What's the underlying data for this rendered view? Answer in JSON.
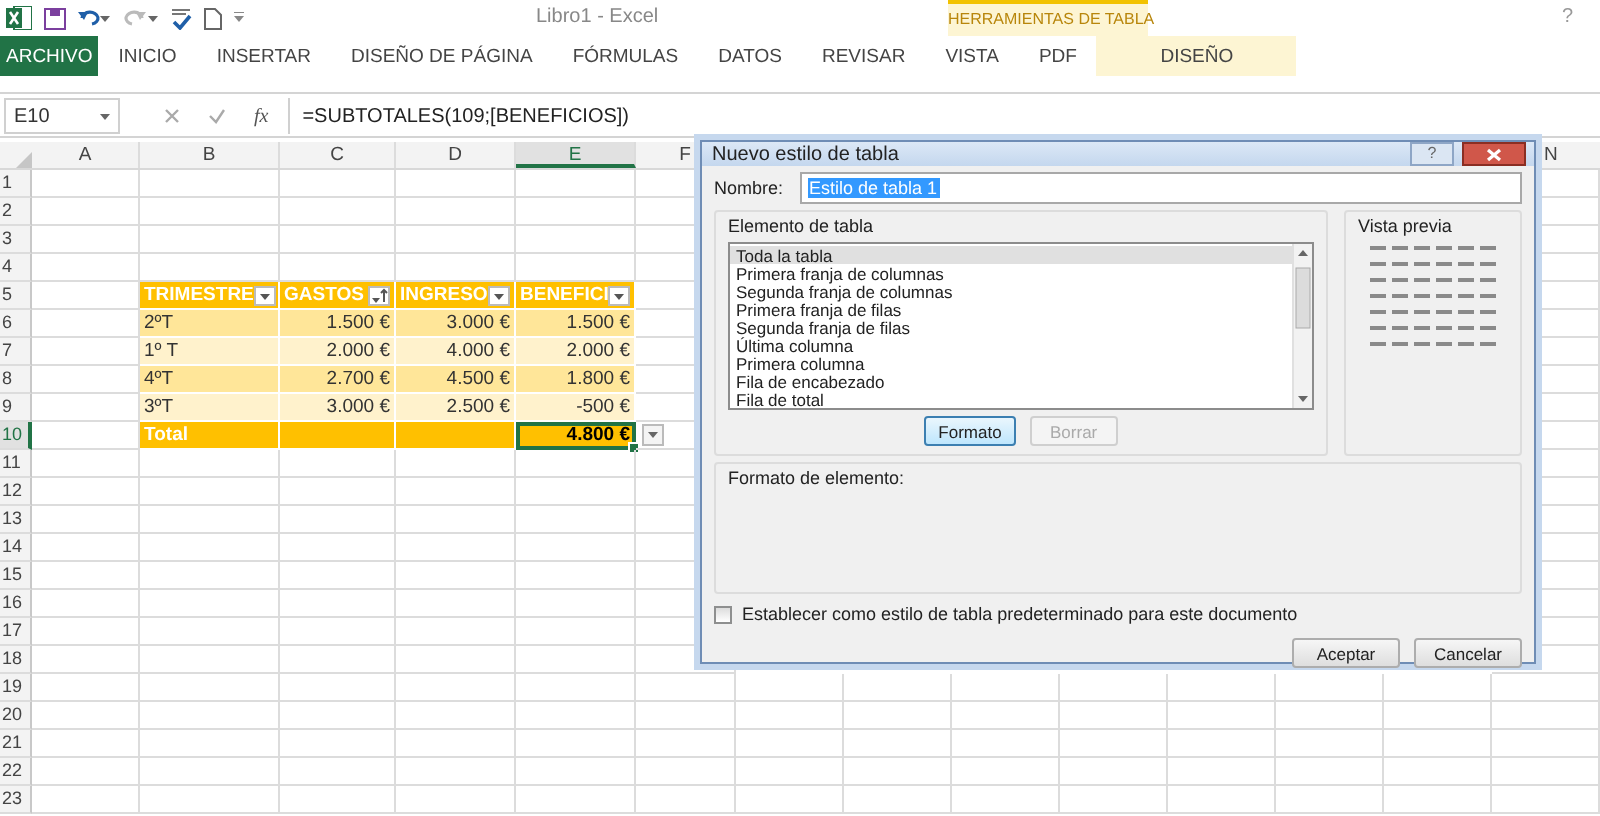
{
  "window": {
    "title": "Libro1 - Excel",
    "help": "?"
  },
  "ribbon": {
    "tabs": [
      {
        "label": "ARCHIVO",
        "kind": "file",
        "selected": false
      },
      {
        "label": "INICIO",
        "kind": "tab",
        "selected": false
      },
      {
        "label": "INSERTAR",
        "kind": "tab",
        "selected": false
      },
      {
        "label": "DISEÑO DE PÁGINA",
        "kind": "tab",
        "selected": false
      },
      {
        "label": "FÓRMULAS",
        "kind": "tab",
        "selected": false
      },
      {
        "label": "DATOS",
        "kind": "tab",
        "selected": false
      },
      {
        "label": "REVISAR",
        "kind": "tab",
        "selected": false
      },
      {
        "label": "VISTA",
        "kind": "tab",
        "selected": false
      },
      {
        "label": "PDF",
        "kind": "tab",
        "selected": false
      }
    ],
    "contextual": {
      "group": "HERRAMIENTAS DE TABLA",
      "tabs": [
        {
          "label": "DISEÑO",
          "selected": false
        }
      ]
    }
  },
  "formula_bar": {
    "name_box": "E10",
    "function_label": "fx",
    "formula": "=SUBTOTALES(109;[BENEFICIOS])"
  },
  "sheet": {
    "columns": [
      {
        "label": "A",
        "selected": false
      },
      {
        "label": "B",
        "selected": false
      },
      {
        "label": "C",
        "selected": false
      },
      {
        "label": "D",
        "selected": false
      },
      {
        "label": "E",
        "selected": true
      },
      {
        "label": "F",
        "selected": false
      },
      {
        "label": "N",
        "selected": false
      }
    ],
    "rows": [
      {
        "number": "1",
        "selected": false,
        "kind": "blank"
      },
      {
        "number": "2",
        "selected": false,
        "kind": "blank"
      },
      {
        "number": "3",
        "selected": false,
        "kind": "blank"
      },
      {
        "number": "4",
        "selected": false,
        "kind": "blank"
      },
      {
        "number": "5",
        "selected": false,
        "kind": "header",
        "cells": [
          {
            "text": "TRIMESTRE",
            "sorted": false,
            "selected": false
          },
          {
            "text": "GASTOS",
            "sorted": true,
            "selected": false
          },
          {
            "text": "INGRESO",
            "sorted": false,
            "selected": false
          },
          {
            "text": "BENEFICI",
            "sorted": false,
            "selected": false
          }
        ]
      },
      {
        "number": "6",
        "selected": false,
        "kind": "band1",
        "cells": [
          {
            "text": "2ºT",
            "selected": false
          },
          {
            "text": "1.500 €",
            "selected": false
          },
          {
            "text": "3.000 €",
            "selected": false
          },
          {
            "text": "1.500 €",
            "selected": false
          }
        ]
      },
      {
        "number": "7",
        "selected": false,
        "kind": "band2",
        "cells": [
          {
            "text": "1º T",
            "selected": false
          },
          {
            "text": "2.000 €",
            "selected": false
          },
          {
            "text": "4.000 €",
            "selected": false
          },
          {
            "text": "2.000 €",
            "selected": false
          }
        ]
      },
      {
        "number": "8",
        "selected": false,
        "kind": "band1",
        "cells": [
          {
            "text": "4ºT",
            "selected": false
          },
          {
            "text": "2.700 €",
            "selected": false
          },
          {
            "text": "4.500 €",
            "selected": false
          },
          {
            "text": "1.800 €",
            "selected": false
          }
        ]
      },
      {
        "number": "9",
        "selected": false,
        "kind": "band2",
        "cells": [
          {
            "text": "3ºT",
            "selected": false
          },
          {
            "text": "3.000 €",
            "selected": false
          },
          {
            "text": "2.500 €",
            "selected": false
          },
          {
            "text": "-500 €",
            "selected": false
          }
        ]
      },
      {
        "number": "10",
        "selected": true,
        "kind": "total",
        "total_dropdown": true,
        "cells": [
          {
            "text": "Total",
            "selected": false
          },
          {
            "selected": false
          },
          {
            "selected": false
          },
          {
            "text": "4.800 €",
            "selected": true
          }
        ]
      },
      {
        "number": "11",
        "selected": false,
        "kind": "blank"
      },
      {
        "number": "12",
        "selected": false,
        "kind": "blank"
      },
      {
        "number": "13",
        "selected": false,
        "kind": "blank"
      },
      {
        "number": "14",
        "selected": false,
        "kind": "blank"
      },
      {
        "number": "15",
        "selected": false,
        "kind": "blank"
      },
      {
        "number": "16",
        "selected": false,
        "kind": "blank"
      },
      {
        "number": "17",
        "selected": false,
        "kind": "blank"
      },
      {
        "number": "18",
        "selected": false,
        "kind": "blank"
      },
      {
        "number": "19",
        "selected": false,
        "kind": "blank"
      },
      {
        "number": "20",
        "selected": false,
        "kind": "blank"
      },
      {
        "number": "21",
        "selected": false,
        "kind": "blank"
      },
      {
        "number": "22",
        "selected": false,
        "kind": "blank"
      },
      {
        "number": "23",
        "selected": false,
        "kind": "blank"
      }
    ]
  },
  "dialog": {
    "title": "Nuevo estilo de tabla",
    "help": "?",
    "name_label": "Nombre:",
    "name_value": "Estilo de tabla 1",
    "elements_label": "Elemento de tabla",
    "elements": [
      {
        "label": "Toda la tabla",
        "selected": true
      },
      {
        "label": "Primera franja de columnas",
        "selected": false
      },
      {
        "label": "Segunda franja de columnas",
        "selected": false
      },
      {
        "label": "Primera franja de filas",
        "selected": false
      },
      {
        "label": "Segunda franja de filas",
        "selected": false
      },
      {
        "label": "Última columna",
        "selected": false
      },
      {
        "label": "Primera columna",
        "selected": false
      },
      {
        "label": "Fila de encabezado",
        "selected": false
      },
      {
        "label": "Fila de total",
        "selected": false
      }
    ],
    "element_buttons": [
      {
        "label": "Formato",
        "focused": true,
        "disabled": false
      },
      {
        "label": "Borrar",
        "focused": false,
        "disabled": true
      }
    ],
    "preview_label": "Vista previa",
    "format_label": "Formato de elemento:",
    "default_checkbox": {
      "label": "Establecer como estilo de tabla predeterminado para este documento",
      "checked": false
    },
    "buttons": [
      {
        "label": "Aceptar",
        "focused": false,
        "disabled": false
      },
      {
        "label": "Cancelar",
        "focused": false,
        "disabled": false
      }
    ]
  }
}
